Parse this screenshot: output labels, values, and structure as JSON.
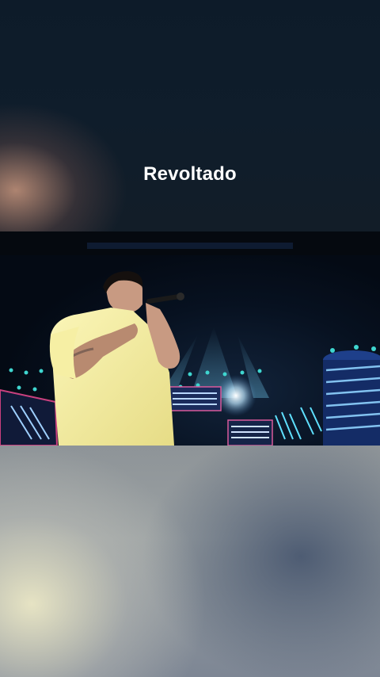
{
  "caption": {
    "text": "Revoltado"
  },
  "colors": {
    "caption_text": "#ffffff",
    "top_background": "#0f1d2b",
    "performer_outfit": "#f2ec9a",
    "stage_lights": "#3fd6d0"
  },
  "icons": {
    "microphone": "microphone-icon"
  }
}
